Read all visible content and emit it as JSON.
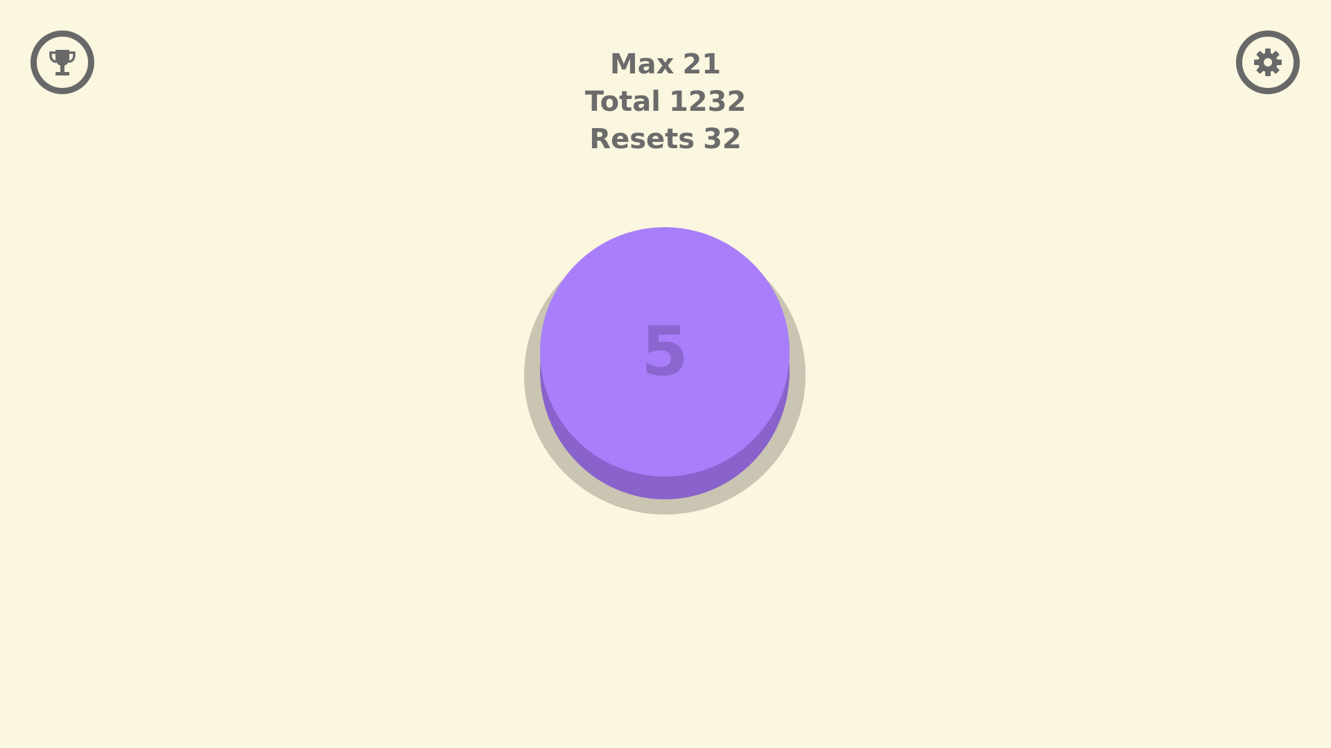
{
  "stats": {
    "max_label": "Max",
    "max_value": "21",
    "total_label": "Total",
    "total_value": "1232",
    "resets_label": "Resets",
    "resets_value": "32"
  },
  "button": {
    "count": "5",
    "color": "#a87efa",
    "side_color": "#8963cb"
  },
  "icons": {
    "left": "trophy-icon",
    "right": "gear-icon"
  },
  "colors": {
    "background": "#faf6df",
    "text": "#6b6b6b"
  }
}
